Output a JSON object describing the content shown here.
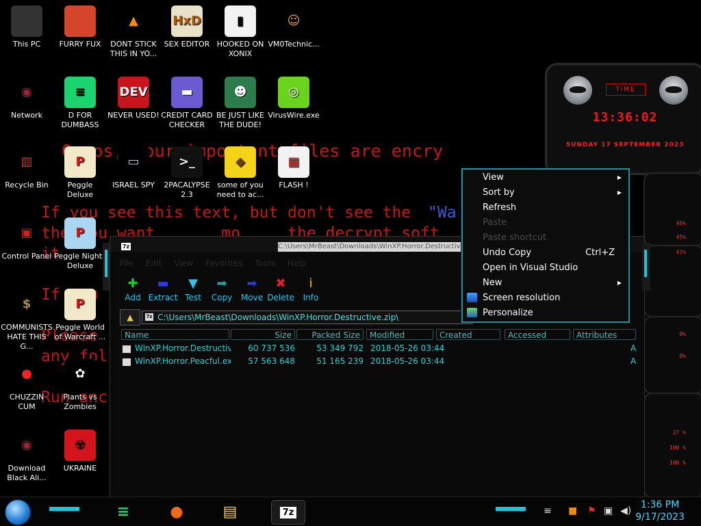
{
  "ransom_lines": [
    "  Ooops, your important files are encry",
    "",
    "",
    "If you see this text, but don't see the",
    "the you want       mo     the decrypt soft",
    "it",
    "",
    "If you",
    "",
    "Please",
    "any fol",
    "",
    "Run anc"
  ],
  "ransom_blue": "\"Wa",
  "desktop": {
    "icons": [
      {
        "label": "This PC",
        "glyph": "",
        "color": "#333",
        "fg": "#fff"
      },
      {
        "label": "FURRY FUX",
        "glyph": "",
        "color": "#d4452c",
        "fg": "#fff"
      },
      {
        "label": "DONT STICK THIS IN YO...",
        "glyph": "▲",
        "color": "#000",
        "fg": "#f08b12"
      },
      {
        "label": "SEX EDITOR",
        "glyph": "HxD",
        "color": "#e8e3c8",
        "fg": "#b15a0a"
      },
      {
        "label": "HOOKED ON XONIX",
        "glyph": "▮",
        "color": "#f2f2f2",
        "fg": "#000"
      },
      {
        "label": "VM0Technic...",
        "glyph": "☺",
        "color": "#000",
        "fg": "#e8a05a"
      },
      {
        "label": "Network",
        "glyph": "◉",
        "color": "#000",
        "fg": "#a0233a"
      },
      {
        "label": "D FOR DUMBASS",
        "glyph": "≡",
        "color": "#1bd46d",
        "fg": "#000"
      },
      {
        "label": "NEVER USED!",
        "glyph": "DEV",
        "color": "#c8141c",
        "fg": "#fff"
      },
      {
        "label": "CREDIT CARD CHECKER",
        "glyph": "▬",
        "color": "#6b5bd1",
        "fg": "#fff"
      },
      {
        "label": "BE JUST LIKE THE DUDE!",
        "glyph": "☻",
        "color": "#2d7d4c",
        "fg": "#fff"
      },
      {
        "label": "VirusWire.exe",
        "glyph": "◎",
        "color": "#6ad41c",
        "fg": "#fff"
      },
      {
        "label": "Recycle Bin",
        "glyph": "▥",
        "color": "#000",
        "fg": "#c33"
      },
      {
        "label": "Peggle Deluxe",
        "glyph": "P",
        "color": "#f2e9c8",
        "fg": "#d41c1c"
      },
      {
        "label": "ISRAEL SPY",
        "glyph": "▭",
        "color": "#000",
        "fg": "#bcd"
      },
      {
        "label": "2PACALYPSE 2.3",
        "glyph": ">_",
        "color": "#111",
        "fg": "#eee"
      },
      {
        "label": "some of you need to ac...",
        "glyph": "◆",
        "color": "#f3d418",
        "fg": "#6a3a12"
      },
      {
        "label": "FLASH !",
        "glyph": "▦",
        "color": "#f2f2f2",
        "fg": "#c33"
      },
      {
        "label": "Control Panel",
        "glyph": "▣",
        "color": "#000",
        "fg": "#c22"
      },
      {
        "label": "Peggle Nights Deluxe",
        "glyph": "P",
        "color": "#a9d7f2",
        "fg": "#d41c1c"
      },
      {
        "label": "COMMUNISTS HATE THIS G...",
        "glyph": "$",
        "color": "#000",
        "fg": "#b08a4a"
      },
      {
        "label": "Peggle World of Warcraft ...",
        "glyph": "P",
        "color": "#f2e9c8",
        "fg": "#d41c1c"
      },
      {
        "label": "CHUZZIN CUM",
        "glyph": "●",
        "color": "#000",
        "fg": "#e22"
      },
      {
        "label": "Plants vs Zombies",
        "glyph": "✿",
        "color": "#000",
        "fg": "#f4f4f4"
      },
      {
        "label": "Download Black Ali...",
        "glyph": "◉",
        "color": "#000",
        "fg": "#a0233a"
      },
      {
        "label": "UKRAINE",
        "glyph": "☢",
        "color": "#d4141c",
        "fg": "#000"
      }
    ]
  },
  "widget": {
    "title": "TIME",
    "time": "13:36:02",
    "date": "SUNDAY 17 SEPTEMBER 2023"
  },
  "meters": {
    "pcts": [
      "46%",
      "45%",
      "41%",
      "0%",
      "0%",
      "27 %",
      "100 %",
      "100 %"
    ]
  },
  "window": {
    "app_icon": "7z",
    "title": "C:\\Users\\MrBeast\\Downloads\\WinXP.Horror.Destructive.zip\\",
    "menu": [
      "File",
      "Edit",
      "View",
      "Favorites",
      "Tools",
      "Help"
    ],
    "toolbar": [
      {
        "label": "Add",
        "glyph": "✚",
        "color": "#21c62a"
      },
      {
        "label": "Extract",
        "glyph": "▬",
        "color": "#2a3bd8"
      },
      {
        "label": "Test",
        "glyph": "▼",
        "color": "#2fc3e6"
      },
      {
        "label": "Copy",
        "glyph": "➡",
        "color": "#2ba0a0"
      },
      {
        "label": "Move",
        "glyph": "➡",
        "color": "#2a3bd8"
      },
      {
        "label": "Delete",
        "glyph": "✖",
        "color": "#e0202a"
      },
      {
        "label": "Info",
        "glyph": "i",
        "color": "#f1c40f"
      }
    ],
    "address": "C:\\Users\\MrBeast\\Downloads\\WinXP.Horror.Destructive.zip\\",
    "address_icon": "7z",
    "columns": [
      "Name",
      "Size",
      "Packed Size",
      "Modified",
      "Created",
      "Accessed",
      "Attributes"
    ],
    "rows": [
      {
        "name": "WinXP.Horror.Destructive....",
        "size": "60 737 536",
        "packed": "53 349 792",
        "modified": "2018-05-26 03:44",
        "attr": "A"
      },
      {
        "name": "WinXP.Horror.Peacful.exe",
        "size": "57 563 648",
        "packed": "51 165 239",
        "modified": "2018-05-26 03:44",
        "attr": "A"
      }
    ]
  },
  "context_menu": {
    "items": [
      {
        "label": "View",
        "shortcut": "",
        "arrow": "▶",
        "disabled": false,
        "icon": ""
      },
      {
        "label": "Sort by",
        "shortcut": "",
        "arrow": "▶",
        "disabled": false,
        "icon": ""
      },
      {
        "label": "Refresh",
        "shortcut": "",
        "arrow": "",
        "disabled": false,
        "icon": ""
      },
      {
        "label": "Paste",
        "shortcut": "",
        "arrow": "",
        "disabled": true,
        "icon": ""
      },
      {
        "label": "Paste shortcut",
        "shortcut": "",
        "arrow": "",
        "disabled": true,
        "icon": ""
      },
      {
        "label": "Undo Copy",
        "shortcut": "Ctrl+Z",
        "arrow": "",
        "disabled": false,
        "icon": ""
      },
      {
        "label": "Open in Visual Studio",
        "shortcut": "",
        "arrow": "",
        "disabled": false,
        "icon": ""
      },
      {
        "label": "New",
        "shortcut": "",
        "arrow": "▶",
        "disabled": false,
        "icon": ""
      },
      {
        "label": "Screen resolution",
        "shortcut": "",
        "arrow": "",
        "disabled": false,
        "icon": "monitor-icon"
      },
      {
        "label": "Personalize",
        "shortcut": "",
        "arrow": "",
        "disabled": false,
        "icon": "personalize-icon"
      }
    ]
  },
  "taskbar": {
    "apps": [
      {
        "name": "speech-app-icon",
        "glyph": "≡",
        "color": "#1bd46d"
      },
      {
        "name": "firefox-icon",
        "glyph": "●",
        "color": "#f06a1a"
      },
      {
        "name": "file-explorer-icon",
        "glyph": "▤",
        "color": "#f2c94c"
      },
      {
        "name": "7zip-icon",
        "glyph": "7z",
        "color": "#fff"
      }
    ],
    "time": "1:36 PM",
    "date": "9/17/2023"
  }
}
